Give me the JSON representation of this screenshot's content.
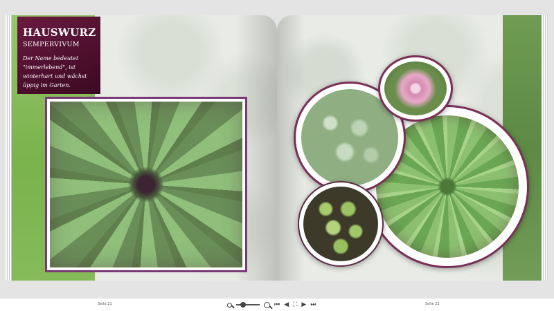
{
  "book": {
    "left_page": {
      "title": "HAUSWURZ",
      "subtitle": "SEMPERVIVUM",
      "description": "Der Name bedeutet \"immerlebend\", ist winterhart und wächst üppig im Garten.",
      "main_photo_subject": "sempervivum-rosette"
    },
    "right_page": {
      "circle_photos": [
        "sempervivum-cluster-bluegreen",
        "sempervivum-flower-pink",
        "sempervivum-cluster-green-balls",
        "sempervivum-rosette-large"
      ]
    }
  },
  "footer": {
    "left_page_label": "Seite 21",
    "right_page_label": "Seite 22",
    "icons": {
      "zoom_out": "zoom-out-icon",
      "zoom_in": "zoom-in-icon",
      "first": "first-page-icon",
      "prev": "prev-page-icon",
      "fullscreen": "fullscreen-icon",
      "next": "next-page-icon",
      "last": "last-page-icon"
    }
  },
  "colors": {
    "title_box": "#4d0f2d",
    "photo_frame": "#7a3a78",
    "background": "#e4e4e4"
  }
}
